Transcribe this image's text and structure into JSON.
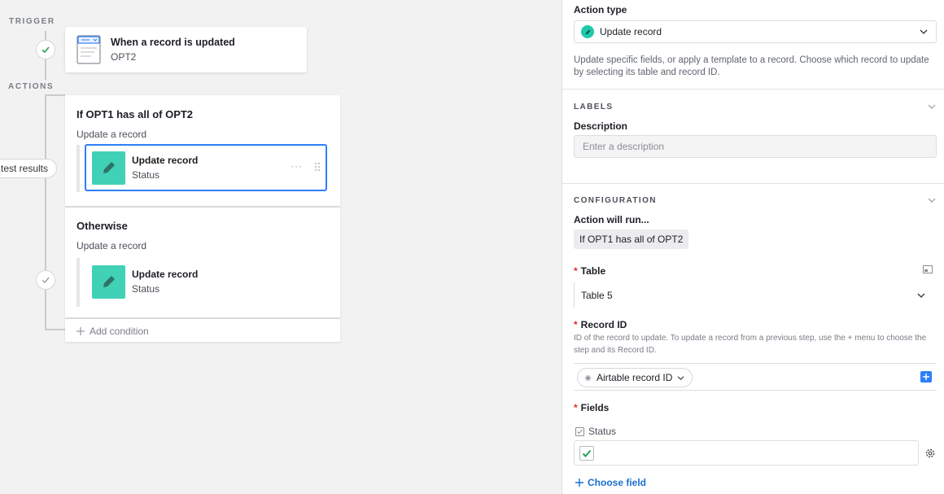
{
  "canvas": {
    "trigger_label": "TRIGGER",
    "actions_label": "ACTIONS",
    "test_results_label": "test results",
    "trigger_card": {
      "title": "When a record is updated",
      "subtitle": "OPT2",
      "icon": "record-updated-icon"
    },
    "condition_block": {
      "title": "If OPT1 has all of OPT2",
      "subtitle": "Update a record",
      "action": {
        "title": "Update record",
        "subtitle": "Status",
        "icon": "pencil-icon"
      }
    },
    "otherwise_block": {
      "title": "Otherwise",
      "subtitle": "Update a record",
      "action": {
        "title": "Update record",
        "subtitle": "Status",
        "icon": "pencil-icon"
      }
    },
    "add_condition_label": "Add condition"
  },
  "panel": {
    "action_type_label": "Action type",
    "action_type_value": "Update record",
    "action_type_description": "Update specific fields, or apply a template to a record. Choose which record to update by selecting its table and record ID.",
    "labels_section": "LABELS",
    "description_label": "Description",
    "description_placeholder": "Enter a description",
    "configuration_section": "CONFIGURATION",
    "action_will_run_label": "Action will run...",
    "condition_chip": "If OPT1 has all of OPT2",
    "table_label": "Table",
    "table_value": "Table 5",
    "record_id_label": "Record ID",
    "record_id_help": "ID of the record to update. To update a record from a previous step, use the + menu to choose the step and its Record ID.",
    "record_id_value": "Airtable record ID",
    "fields_label": "Fields",
    "field_name": "Status",
    "field_checked": true,
    "choose_field_label": "Choose field"
  },
  "colors": {
    "accent": "#2d7ff9",
    "teal": "#20c9aa",
    "link": "#1a6fd1",
    "required": "#e02b2b",
    "check_green": "#20a357"
  }
}
